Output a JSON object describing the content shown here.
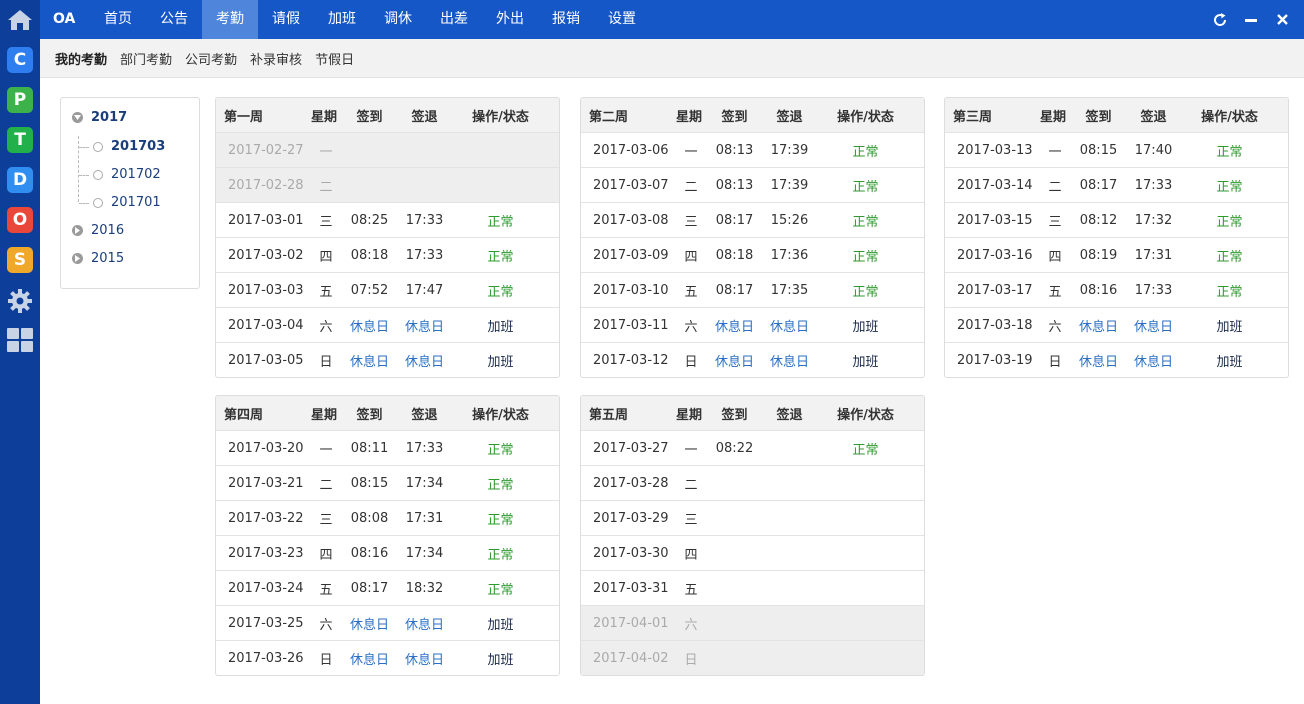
{
  "app": {
    "brand": "OA"
  },
  "nav": {
    "items": [
      "首页",
      "公告",
      "考勤",
      "请假",
      "加班",
      "调休",
      "出差",
      "外出",
      "报销",
      "设置"
    ],
    "active_index": 2
  },
  "subnav": {
    "items": [
      "我的考勤",
      "部门考勤",
      "公司考勤",
      "补录审核",
      "节假日"
    ],
    "active_index": 0
  },
  "rail": {
    "tiles": [
      {
        "letter": "C",
        "color": "#2f7ef0"
      },
      {
        "letter": "P",
        "color": "#3bb24a"
      },
      {
        "letter": "T",
        "color": "#22b04a"
      },
      {
        "letter": "D",
        "color": "#2f8ef0"
      },
      {
        "letter": "O",
        "color": "#e8473a"
      },
      {
        "letter": "S",
        "color": "#f0a82a"
      }
    ]
  },
  "tree": {
    "years": [
      {
        "label": "2017",
        "expanded": true,
        "months": [
          "201703",
          "201702",
          "201701"
        ],
        "selected": "201703"
      },
      {
        "label": "2016",
        "expanded": false
      },
      {
        "label": "2015",
        "expanded": false
      }
    ]
  },
  "table_headers": {
    "weekday": "星期",
    "checkin": "签到",
    "checkout": "签退",
    "status": "操作/状态"
  },
  "weeks": [
    {
      "title": "第一周",
      "rows": [
        {
          "date": "2017-02-27",
          "weekday": "一",
          "in": "",
          "out": "",
          "status": "",
          "type": "past"
        },
        {
          "date": "2017-02-28",
          "weekday": "二",
          "in": "",
          "out": "",
          "status": "",
          "type": "past"
        },
        {
          "date": "2017-03-01",
          "weekday": "三",
          "in": "08:25",
          "out": "17:33",
          "status": "正常",
          "type": "normal"
        },
        {
          "date": "2017-03-02",
          "weekday": "四",
          "in": "08:18",
          "out": "17:33",
          "status": "正常",
          "type": "normal"
        },
        {
          "date": "2017-03-03",
          "weekday": "五",
          "in": "07:52",
          "out": "17:47",
          "status": "正常",
          "type": "normal"
        },
        {
          "date": "2017-03-04",
          "weekday": "六",
          "in": "休息日",
          "out": "休息日",
          "status": "加班",
          "type": "rest"
        },
        {
          "date": "2017-03-05",
          "weekday": "日",
          "in": "休息日",
          "out": "休息日",
          "status": "加班",
          "type": "rest"
        }
      ]
    },
    {
      "title": "第二周",
      "rows": [
        {
          "date": "2017-03-06",
          "weekday": "一",
          "in": "08:13",
          "out": "17:39",
          "status": "正常",
          "type": "normal"
        },
        {
          "date": "2017-03-07",
          "weekday": "二",
          "in": "08:13",
          "out": "17:39",
          "status": "正常",
          "type": "normal"
        },
        {
          "date": "2017-03-08",
          "weekday": "三",
          "in": "08:17",
          "out": "15:26",
          "status": "正常",
          "type": "normal"
        },
        {
          "date": "2017-03-09",
          "weekday": "四",
          "in": "08:18",
          "out": "17:36",
          "status": "正常",
          "type": "normal"
        },
        {
          "date": "2017-03-10",
          "weekday": "五",
          "in": "08:17",
          "out": "17:35",
          "status": "正常",
          "type": "normal"
        },
        {
          "date": "2017-03-11",
          "weekday": "六",
          "in": "休息日",
          "out": "休息日",
          "status": "加班",
          "type": "rest"
        },
        {
          "date": "2017-03-12",
          "weekday": "日",
          "in": "休息日",
          "out": "休息日",
          "status": "加班",
          "type": "rest"
        }
      ]
    },
    {
      "title": "第三周",
      "rows": [
        {
          "date": "2017-03-13",
          "weekday": "一",
          "in": "08:15",
          "out": "17:40",
          "status": "正常",
          "type": "normal"
        },
        {
          "date": "2017-03-14",
          "weekday": "二",
          "in": "08:17",
          "out": "17:33",
          "status": "正常",
          "type": "normal"
        },
        {
          "date": "2017-03-15",
          "weekday": "三",
          "in": "08:12",
          "out": "17:32",
          "status": "正常",
          "type": "normal"
        },
        {
          "date": "2017-03-16",
          "weekday": "四",
          "in": "08:19",
          "out": "17:31",
          "status": "正常",
          "type": "normal"
        },
        {
          "date": "2017-03-17",
          "weekday": "五",
          "in": "08:16",
          "out": "17:33",
          "status": "正常",
          "type": "normal"
        },
        {
          "date": "2017-03-18",
          "weekday": "六",
          "in": "休息日",
          "out": "休息日",
          "status": "加班",
          "type": "rest"
        },
        {
          "date": "2017-03-19",
          "weekday": "日",
          "in": "休息日",
          "out": "休息日",
          "status": "加班",
          "type": "rest"
        }
      ]
    },
    {
      "title": "第四周",
      "rows": [
        {
          "date": "2017-03-20",
          "weekday": "一",
          "in": "08:11",
          "out": "17:33",
          "status": "正常",
          "type": "normal"
        },
        {
          "date": "2017-03-21",
          "weekday": "二",
          "in": "08:15",
          "out": "17:34",
          "status": "正常",
          "type": "normal"
        },
        {
          "date": "2017-03-22",
          "weekday": "三",
          "in": "08:08",
          "out": "17:31",
          "status": "正常",
          "type": "normal"
        },
        {
          "date": "2017-03-23",
          "weekday": "四",
          "in": "08:16",
          "out": "17:34",
          "status": "正常",
          "type": "normal"
        },
        {
          "date": "2017-03-24",
          "weekday": "五",
          "in": "08:17",
          "out": "18:32",
          "status": "正常",
          "type": "normal"
        },
        {
          "date": "2017-03-25",
          "weekday": "六",
          "in": "休息日",
          "out": "休息日",
          "status": "加班",
          "type": "rest"
        },
        {
          "date": "2017-03-26",
          "weekday": "日",
          "in": "休息日",
          "out": "休息日",
          "status": "加班",
          "type": "rest"
        }
      ]
    },
    {
      "title": "第五周",
      "rows": [
        {
          "date": "2017-03-27",
          "weekday": "一",
          "in": "08:22",
          "out": "",
          "status": "正常",
          "type": "normal"
        },
        {
          "date": "2017-03-28",
          "weekday": "二",
          "in": "",
          "out": "",
          "status": "",
          "type": "normal"
        },
        {
          "date": "2017-03-29",
          "weekday": "三",
          "in": "",
          "out": "",
          "status": "",
          "type": "normal"
        },
        {
          "date": "2017-03-30",
          "weekday": "四",
          "in": "",
          "out": "",
          "status": "",
          "type": "normal"
        },
        {
          "date": "2017-03-31",
          "weekday": "五",
          "in": "",
          "out": "",
          "status": "",
          "type": "normal"
        },
        {
          "date": "2017-04-01",
          "weekday": "六",
          "in": "",
          "out": "",
          "status": "",
          "type": "past"
        },
        {
          "date": "2017-04-02",
          "weekday": "日",
          "in": "",
          "out": "",
          "status": "",
          "type": "past"
        }
      ]
    }
  ]
}
